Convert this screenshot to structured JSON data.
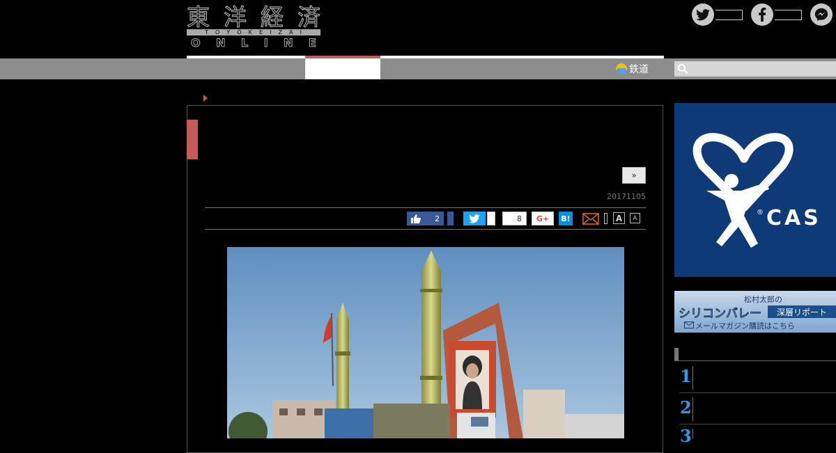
{
  "logo": {
    "kanji": [
      "東",
      "洋",
      "経",
      "済"
    ],
    "sub_letters": [
      "T",
      "O",
      "Y",
      "O",
      "K",
      "E",
      "I",
      "Z",
      "A",
      "I"
    ],
    "online_letters": [
      "O",
      "N",
      "L",
      "I",
      "N",
      "E"
    ]
  },
  "header": {
    "social": [
      {
        "name": "twitter",
        "glyph": "t"
      },
      {
        "name": "facebook",
        "glyph": "f"
      },
      {
        "name": "messenger",
        "glyph": "~"
      }
    ]
  },
  "nav": {
    "rail_label": "鉄道"
  },
  "article": {
    "next_label": "»",
    "date": "20171105",
    "share": {
      "facebook_like_count": "2",
      "count_label": "8",
      "google_plus_label": "G+",
      "hatena_label": "B!",
      "font_large": "A",
      "font_small": "A"
    }
  },
  "sidebar": {
    "ad1": {
      "text": "CAS",
      "mark": "®"
    },
    "ad2": {
      "line1": "松村太郎の",
      "line2": "シリコンバレー",
      "tag": "深層リポート",
      "line3": "メールマガジン購読はこちら"
    },
    "ranking": [
      "1",
      "2",
      "3"
    ]
  },
  "colors": {
    "accent": "#c65a5a",
    "nav_bg": "#8c8c8c",
    "facebook": "#3b5998",
    "twitter": "#1da1f2",
    "hatena": "#008fde",
    "rank": "#2a9be8",
    "ad_blue": "#0e3a78"
  }
}
